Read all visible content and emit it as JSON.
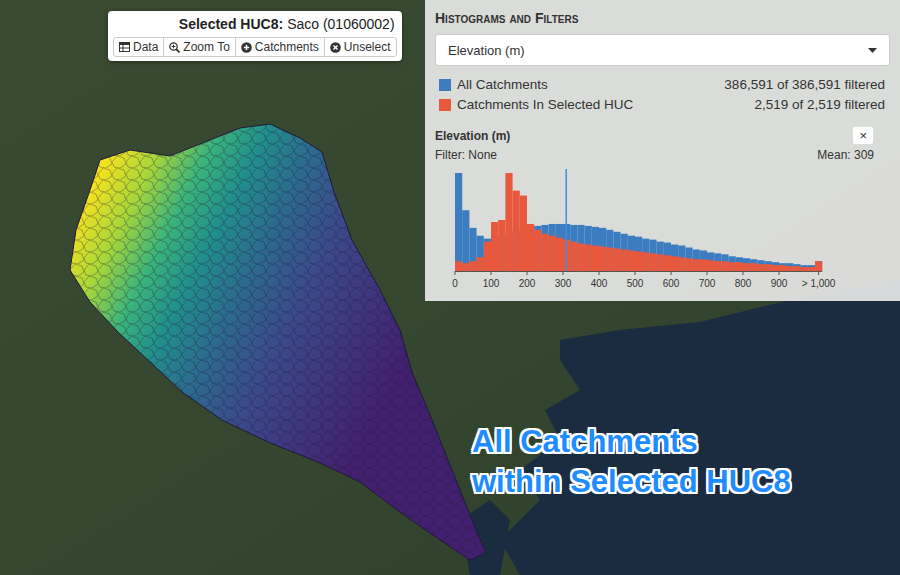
{
  "selection_popup": {
    "label": "Selected HUC8:",
    "value": "Saco (01060002)",
    "buttons": [
      {
        "label": "Data"
      },
      {
        "label": "Zoom To"
      },
      {
        "label": "Catchments"
      },
      {
        "label": "Unselect"
      }
    ]
  },
  "panel": {
    "title": "Histograms and Filters",
    "variable_select": {
      "value": "Elevation (m)"
    },
    "legend": [
      {
        "label": "All Catchments",
        "count": "386,591 of 386,591 filtered",
        "color": "#3b7dc0"
      },
      {
        "label": "Catchments In Selected HUC",
        "count": "2,519 of 2,519 filtered",
        "color": "#e8583c"
      }
    ],
    "chart": {
      "title": "Elevation (m)",
      "close": "×",
      "filter": "Filter: None",
      "mean_label": "Mean: 309",
      "mean": 309,
      "bin_width": 20,
      "ticks": [
        "0",
        "100",
        "200",
        "300",
        "400",
        "500",
        "600",
        "700",
        "800",
        "900",
        "> 1,000"
      ],
      "series": [
        {
          "name": "All Catchments",
          "values": [
            100,
            62,
            44,
            36,
            33,
            34,
            36,
            38,
            41,
            43,
            45,
            46,
            47,
            48,
            48,
            48,
            47,
            47,
            46,
            45,
            44,
            42,
            40,
            38,
            36,
            35,
            33,
            32,
            30,
            29,
            27,
            26,
            24,
            22,
            21,
            19,
            18,
            17,
            15,
            14,
            13,
            12,
            11,
            10,
            9,
            8,
            8,
            7,
            6,
            6,
            10
          ]
        },
        {
          "name": "Catchments In Selected HUC",
          "values": [
            10,
            8,
            10,
            14,
            30,
            50,
            52,
            100,
            82,
            77,
            48,
            42,
            38,
            36,
            34,
            32,
            30,
            28,
            27,
            26,
            25,
            24,
            23,
            22,
            21,
            20,
            19,
            18,
            17,
            16,
            15,
            14,
            13,
            12,
            12,
            11,
            10,
            10,
            9,
            9,
            8,
            8,
            7,
            7,
            6,
            6,
            5,
            5,
            4,
            4,
            10
          ]
        }
      ]
    }
  },
  "annotation": {
    "lines": [
      "All Catchments",
      "within Selected HUC8"
    ]
  }
}
